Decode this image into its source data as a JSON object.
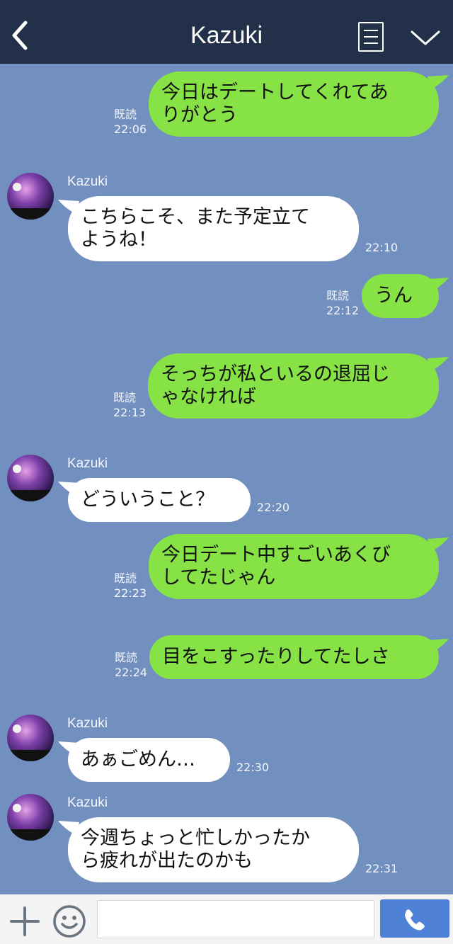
{
  "header": {
    "title": "Kazuki",
    "bg_color": "#233049"
  },
  "colors": {
    "chat_bg": "#7290bf",
    "out_bubble": "#86e245",
    "in_bubble": "#ffffff",
    "call_button": "#4f81d6"
  },
  "messages": [
    {
      "direction": "out",
      "text": "今日はデートしてくれてあ\nりがとう",
      "read": "既読",
      "time": "22:06"
    },
    {
      "direction": "in",
      "sender": "Kazuki",
      "text": "こちらこそ、また予定立て\nようね！",
      "time": "22:10"
    },
    {
      "direction": "out",
      "text": "うん",
      "read": "既読",
      "time": "22:12"
    },
    {
      "direction": "out",
      "text": "そっちが私といるの退屈じ\nゃなければ",
      "read": "既読",
      "time": "22:13"
    },
    {
      "direction": "in",
      "sender": "Kazuki",
      "text": "どういうこと？",
      "time": "22:20"
    },
    {
      "direction": "out",
      "text": "今日デート中すごいあくび\nしてたじゃん",
      "read": "既読",
      "time": "22:23"
    },
    {
      "direction": "out",
      "text": "目をこすったりしてたしさ",
      "read": "既読",
      "time": "22:24"
    },
    {
      "direction": "in",
      "sender": "Kazuki",
      "text": "あぁごめん…",
      "time": "22:30"
    },
    {
      "direction": "in",
      "sender": "Kazuki",
      "text": "今週ちょっと忙しかったか\nら疲れが出たのかも",
      "time": "22:31"
    }
  ],
  "footer": {
    "input_value": "",
    "icons": [
      "plus-icon",
      "smiley-icon",
      "phone-icon"
    ]
  }
}
